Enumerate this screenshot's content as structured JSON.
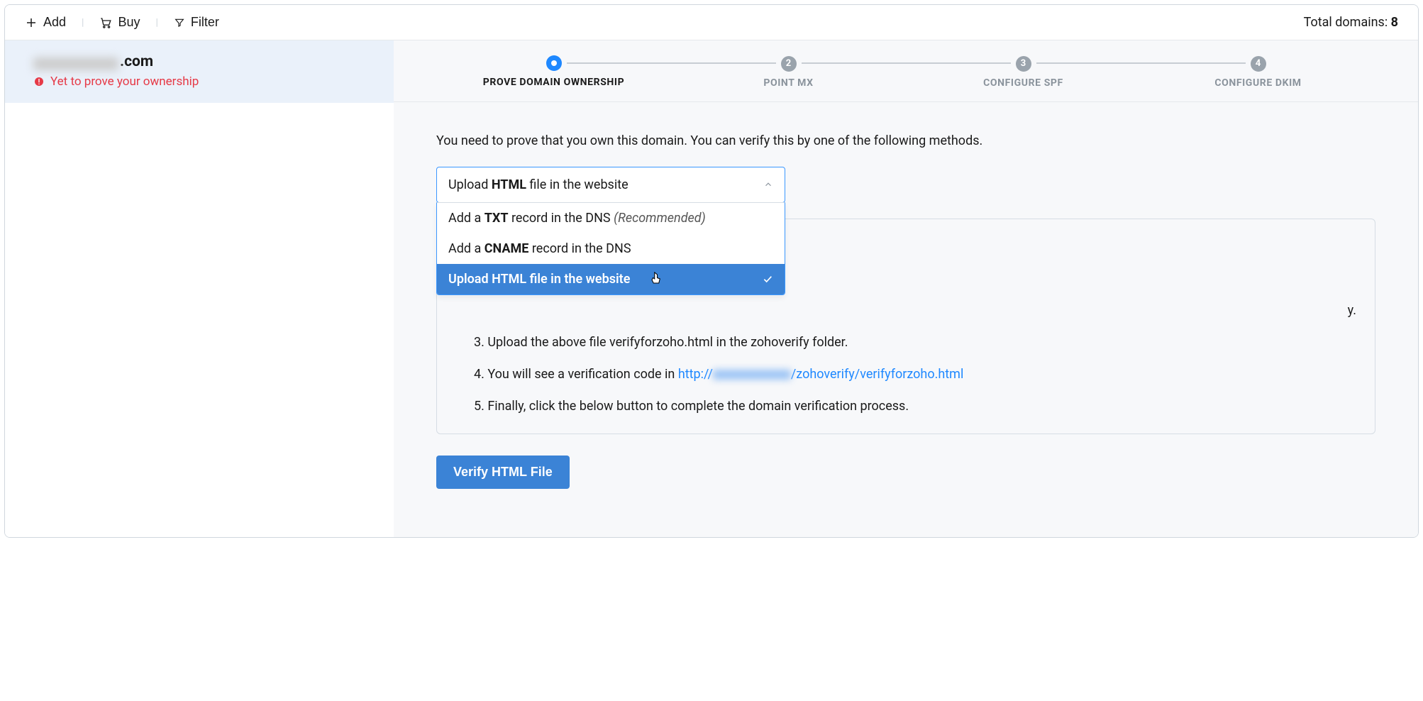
{
  "toolbar": {
    "add_label": "Add",
    "buy_label": "Buy",
    "filter_label": "Filter",
    "total_label": "Total domains: ",
    "total_count": "8"
  },
  "sidebar": {
    "domain_suffix": ".com",
    "status_text": "Yet to prove your ownership"
  },
  "stepper": {
    "steps": [
      {
        "num": "",
        "label": "PROVE DOMAIN OWNERSHIP",
        "active": true
      },
      {
        "num": "2",
        "label": "POINT MX",
        "active": false
      },
      {
        "num": "3",
        "label": "CONFIGURE SPF",
        "active": false
      },
      {
        "num": "4",
        "label": "CONFIGURE DKIM",
        "active": false
      }
    ]
  },
  "content": {
    "intro": "You need to prove that you own this domain. You can verify this by one of the following methods.",
    "select_trigger_prefix": "Upload ",
    "select_trigger_bold": "HTML",
    "select_trigger_suffix": " file in the website",
    "options": {
      "txt_prefix": "Add a ",
      "txt_bold": "TXT",
      "txt_suffix": " record in the DNS ",
      "txt_rec": "(Recommended)",
      "cname_prefix": "Add a ",
      "cname_bold": "CNAME",
      "cname_suffix": " record in the DNS",
      "html_label": "Upload HTML file in the website"
    },
    "steps": {
      "s3": "3. Upload the above file verifyforzoho.html in the zohoverify folder.",
      "s4_prefix": "4. You will see a verification code in ",
      "s4_link_prefix": "http://",
      "s4_link_suffix": "/zohoverify/verifyforzoho.html",
      "s5": "5. Finally, click the below button to complete the domain verification process.",
      "hidden_trail": "y."
    },
    "verify_button": "Verify HTML File"
  }
}
